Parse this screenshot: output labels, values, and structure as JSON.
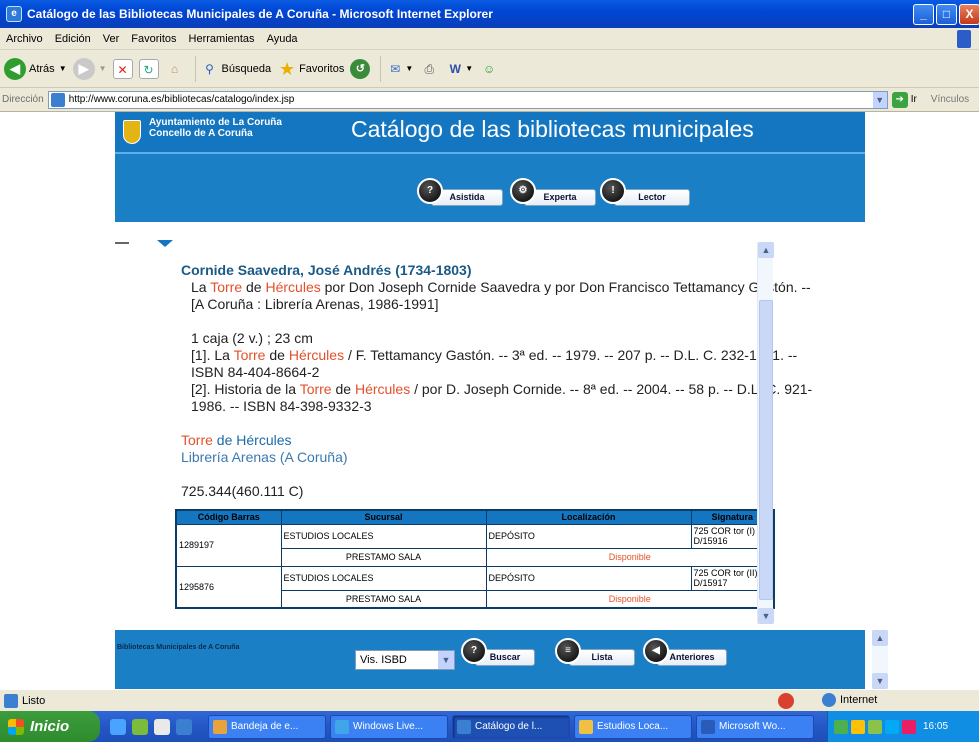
{
  "window": {
    "title": "Catálogo de las Bibliotecas Municipales de A Coruña - Microsoft Internet Explorer",
    "min": "_",
    "max": "□",
    "close": "X"
  },
  "menu": [
    "Archivo",
    "Edición",
    "Ver",
    "Favoritos",
    "Herramientas",
    "Ayuda"
  ],
  "toolbar": {
    "back": "Atrás",
    "search": "Búsqueda",
    "favorites": "Favoritos"
  },
  "address": {
    "label": "Dirección",
    "url": "http://www.coruna.es/bibliotecas/catalogo/index.jsp",
    "go": "Ir",
    "links": "Vínculos"
  },
  "header": {
    "ayto_line1": "Ayuntamiento de La Coruña",
    "ayto_line2": "Concello de A Coruña",
    "title": "Catálogo de las bibliotecas municipales",
    "nav": [
      "Asistida",
      "Experta",
      "Lector"
    ]
  },
  "record": {
    "author": "Cornide Saavedra, José Andrés (1734-1803)",
    "title_pre": "La ",
    "hl1": "Torre",
    "mid1": " de ",
    "hl2": "Hércules",
    "title_post": " por Don Joseph Cornide Saavedra y por Don Francisco Tettamancy Gastón. -- [A Coruña : Librería Arenas, 1986-1991]",
    "physical": "1 caja (2 v.) ; 23 cm",
    "c1_pre": "[1]. La ",
    "c1_post": " / F. Tettamancy Gastón. -- 3ª ed. -- 1979. -- 207 p. -- D.L. C. 232-1991. -- ISBN 84-404-8664-2",
    "c2_pre": "[2]. Historia de la ",
    "c2_post": " / por D. Joseph Cornide. -- 8ª ed. -- 2004. -- 58 p. -- D.L. C. 921-1986. -- ISBN 84-398-9332-3",
    "subject_hl": "Torre",
    "subject_rest": " de Hércules",
    "place": "Librería Arenas (A Coruña)",
    "classification": "725.344(460.111 C)"
  },
  "copies": {
    "headers": [
      "Código Barras",
      "Sucursal",
      "Localización",
      "Signatura"
    ],
    "rows": [
      {
        "barcode": "1289197",
        "branch": "ESTUDIOS LOCALES",
        "location": "DEPÓSITO",
        "signature": "725 COR tor (I) D/15916",
        "loan": "PRESTAMO SALA",
        "status": "Disponible"
      },
      {
        "barcode": "1295876",
        "branch": "ESTUDIOS LOCALES",
        "location": "DEPÓSITO",
        "signature": "725 COR tor (II) D/15917",
        "loan": "PRESTAMO SALA",
        "status": "Disponible"
      }
    ]
  },
  "footer": {
    "label": "Bibliotecas Municipales de A Coruña",
    "view": "Vis. ISBD",
    "buttons": [
      "Buscar",
      "Lista",
      "Anteriores"
    ]
  },
  "status": {
    "left": "Listo",
    "zone": "Internet"
  },
  "taskbar": {
    "start": "Inicio",
    "tasks": [
      "Bandeja de e...",
      "Windows Live...",
      "Catálogo de l...",
      "Estudios Loca...",
      "Microsoft Wo..."
    ],
    "clock": "16:05"
  },
  "colors": {
    "accent": "#1476c0",
    "highlight": "#e4502a",
    "author": "#1b5a86"
  }
}
